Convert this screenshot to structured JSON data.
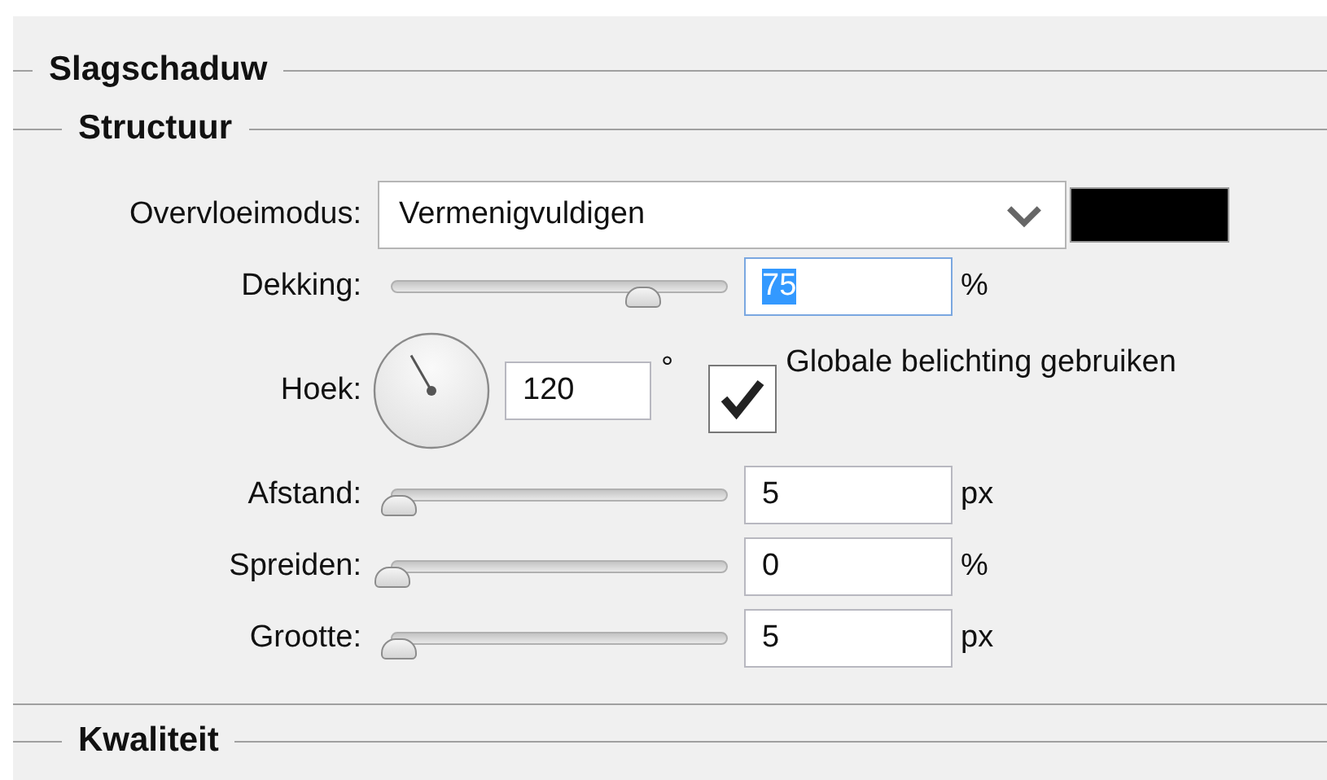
{
  "title": "Slagschaduw",
  "section": "Structuur",
  "blend": {
    "label": "Overvloeimodus:",
    "value": "Vermenigvuldigen",
    "color": "#000000"
  },
  "rows": [
    {
      "kind": "slider",
      "label": "Dekking:",
      "level": 0.75,
      "value": "75",
      "unit": "%",
      "focused": true
    },
    {
      "kind": "angle",
      "label": "Hoek:",
      "value": "120",
      "unit": "°",
      "checkbox": {
        "label": "Globale belichting gebruiken",
        "checked": true
      }
    },
    {
      "kind": "slider",
      "label": "Afstand:",
      "level": 0.02,
      "value": "5",
      "unit": "px",
      "focused": false
    },
    {
      "kind": "slider",
      "label": "Spreiden:",
      "level": 0,
      "value": "0",
      "unit": "%",
      "focused": false
    },
    {
      "kind": "slider",
      "label": "Grootte:",
      "level": 0.02,
      "value": "5",
      "unit": "px",
      "focused": false
    }
  ],
  "next_section": "Kwaliteit"
}
